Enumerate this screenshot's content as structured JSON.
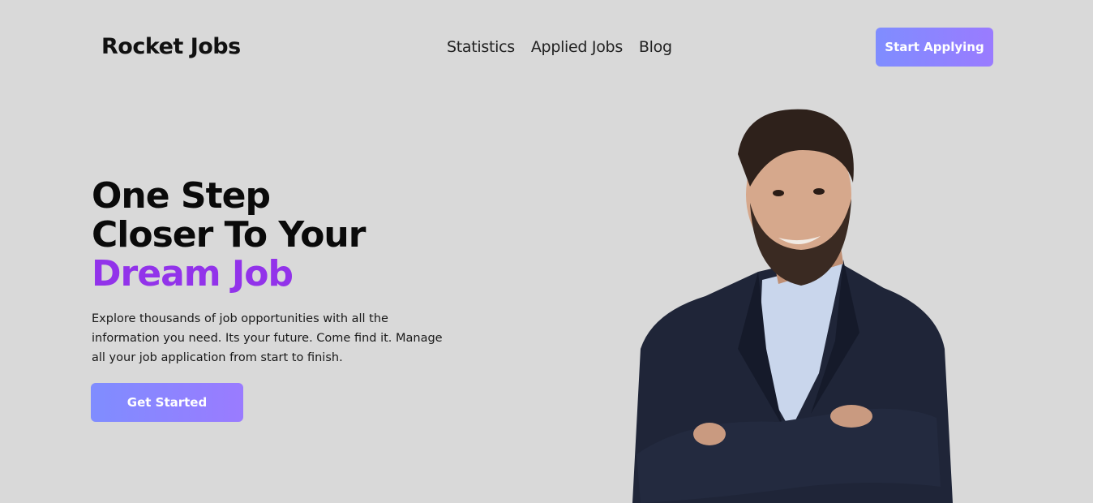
{
  "header": {
    "logo": "Rocket Jobs",
    "nav": [
      {
        "label": "Statistics"
      },
      {
        "label": "Applied Jobs"
      },
      {
        "label": "Blog"
      }
    ],
    "cta_label": "Start Applying"
  },
  "hero": {
    "title_line1": "One Step",
    "title_line2": "Closer To Your",
    "title_accent": "Dream Job",
    "description": "Explore thousands of job opportunities with all the information you need. Its your future. Come find it. Manage all your job application from start to finish.",
    "button_label": "Get Started",
    "image_icon": "person-photo"
  },
  "colors": {
    "background": "#d9d9d9",
    "accent": "#9233ea",
    "button_gradient_start": "#7f8dff",
    "button_gradient_end": "#9a7bff"
  }
}
